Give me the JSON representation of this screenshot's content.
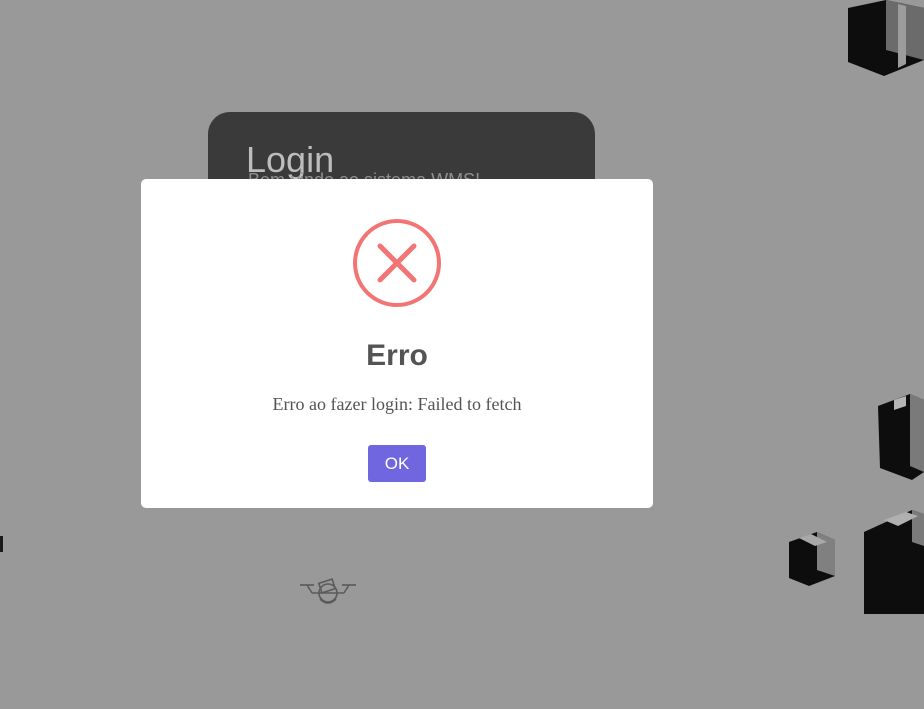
{
  "background": {
    "login_title": "Login",
    "login_subtitle": "Bem-vindo ao sistema WMS!",
    "footer_text": "",
    "overlay_color": "#999999"
  },
  "dialog": {
    "icon": "error-x-icon",
    "icon_color": "#f27474",
    "title": "Erro",
    "message": "Erro ao fazer login: Failed to fetch",
    "confirm_label": "OK",
    "confirm_color": "#7066e0"
  }
}
